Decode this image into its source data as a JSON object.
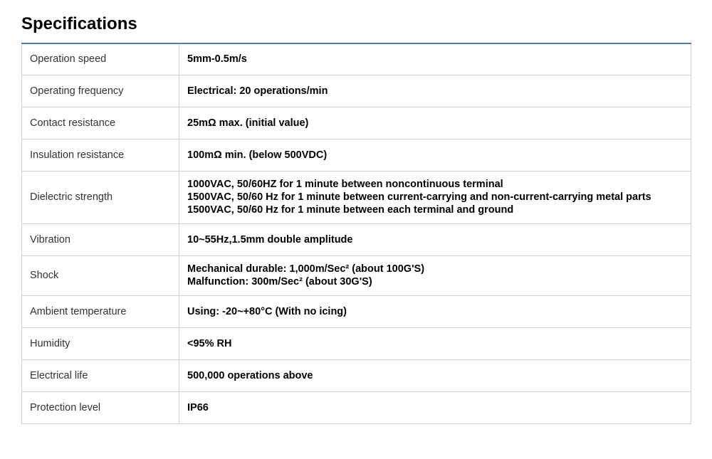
{
  "page": {
    "title": "Specifications"
  },
  "colors": {
    "header_rule": "#4a7fb8",
    "grid_line": "#d2d2d2",
    "label_text": "#333333",
    "value_text": "#000000"
  },
  "specs": [
    {
      "label": "Operation speed",
      "lines": [
        "5mm-0.5m/s"
      ]
    },
    {
      "label": "Operating frequency",
      "lines": [
        "Electrical: 20 operations/min"
      ]
    },
    {
      "label": "Contact resistance",
      "lines": [
        "25mΩ max. (initial value)"
      ]
    },
    {
      "label": "Insulation resistance",
      "lines": [
        "100mΩ min. (below 500VDC)"
      ]
    },
    {
      "label": "Dielectric strength",
      "lines": [
        "1000VAC, 50/60HZ for 1 minute between noncontinuous terminal",
        "1500VAC, 50/60 Hz for 1 minute between current-carrying and non-current-carrying metal parts",
        "1500VAC, 50/60 Hz for 1 minute between each terminal and ground"
      ]
    },
    {
      "label": "Vibration",
      "lines": [
        "10~55Hz,1.5mm double amplitude"
      ]
    },
    {
      "label": "Shock",
      "lines": [
        "Mechanical durable: 1,000m/Sec² (about 100G'S)",
        "Malfunction: 300m/Sec² (about 30G'S)"
      ]
    },
    {
      "label": "Ambient temperature",
      "lines": [
        "Using: -20~+80°C (With no icing)"
      ]
    },
    {
      "label": "Humidity",
      "lines": [
        "<95% RH"
      ]
    },
    {
      "label": "Electrical life",
      "lines": [
        "500,000 operations above"
      ]
    },
    {
      "label": "Protection level",
      "lines": [
        "IP66"
      ]
    }
  ]
}
